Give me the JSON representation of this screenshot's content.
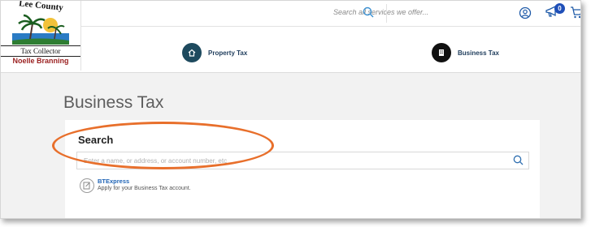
{
  "brand": {
    "arc_text": "Lee County",
    "line1": "Tax Collector",
    "line2": "Noelle Branning"
  },
  "topbar": {
    "search_placeholder": "Search all services we offer...",
    "cart_count": "0"
  },
  "nav": {
    "items": [
      {
        "label": "Property Tax",
        "icon": "house-icon",
        "color": "#1e4a5e"
      },
      {
        "label": "Business Tax",
        "icon": "building-icon",
        "color": "#111111"
      }
    ]
  },
  "main": {
    "title": "Business Tax",
    "search": {
      "label": "Search",
      "placeholder": "Enter a name, or address, or account number, etc"
    },
    "service": {
      "name": "BTExpress",
      "description": "Apply for your Business Tax account."
    }
  },
  "colors": {
    "accent": "#1e63b5",
    "annotation": "#e86f2b",
    "badge": "#1f4fb8"
  }
}
